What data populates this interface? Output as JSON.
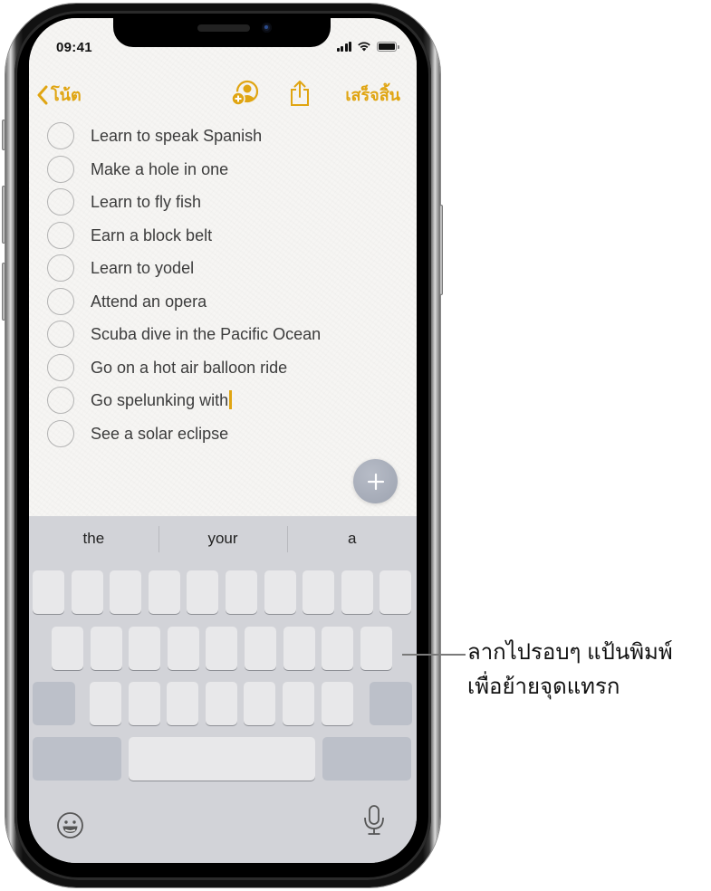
{
  "status_bar": {
    "time": "09:41"
  },
  "navbar": {
    "back_label": "โน้ต",
    "back_icon": "chevron-left-icon",
    "add_person_icon": "add-person-icon",
    "share_icon": "share-icon",
    "done_label": "เสร็จสิ้น"
  },
  "checklist": {
    "items": [
      {
        "text": "Learn to speak Spanish",
        "checked": false
      },
      {
        "text": "Make a hole in one",
        "checked": false
      },
      {
        "text": "Learn to fly fish",
        "checked": false
      },
      {
        "text": "Earn a block belt",
        "checked": false
      },
      {
        "text": "Learn to yodel",
        "checked": false
      },
      {
        "text": "Attend an opera",
        "checked": false
      },
      {
        "text": "Scuba dive in the Pacific Ocean",
        "checked": false
      },
      {
        "text": "Go on a hot air balloon ride",
        "checked": false
      },
      {
        "text": "Go spelunking with",
        "checked": false,
        "has_caret": true
      },
      {
        "text": "See a solar eclipse",
        "checked": false
      }
    ]
  },
  "add_button": {
    "icon": "plus-icon"
  },
  "keyboard": {
    "predictions": [
      "the",
      "your",
      "a"
    ],
    "emoji_icon": "emoji-icon",
    "mic_icon": "microphone-icon",
    "state": "trackpad-mode-blank-keys"
  },
  "colors": {
    "accent": "#e0a512",
    "paper": "#f6f5f3",
    "keyboard_bg": "#d2d3d8",
    "key": "#e8e8ea",
    "key_dark": "#bcc0c9"
  },
  "callout": {
    "text": "ลากไปรอบๆ แป้นพิมพ์\nเพื่อย้ายจุดแทรก"
  }
}
